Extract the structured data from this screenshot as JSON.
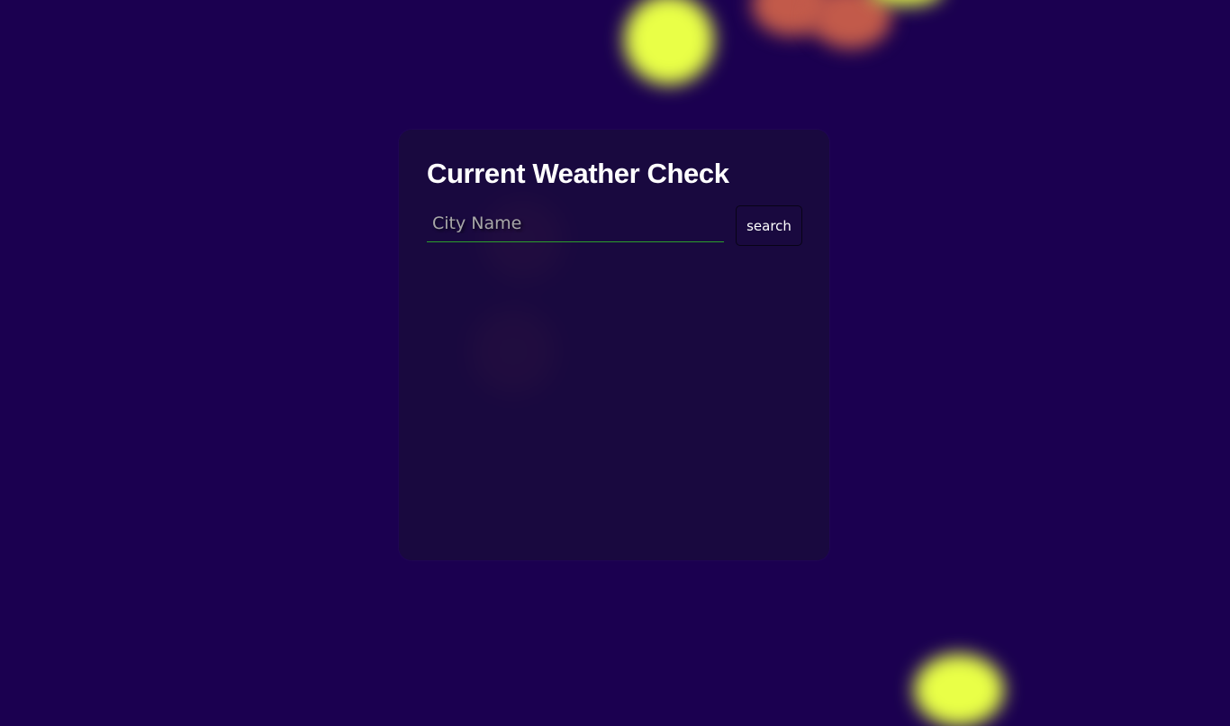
{
  "app": {
    "title": "Current Weather Check"
  },
  "search": {
    "placeholder": "City Name",
    "button_label": "search"
  },
  "theme": {
    "background": "#1b0050",
    "card": "#190a3e",
    "accent": "#2ca02c",
    "blob_yellow": "#e9ff47",
    "blob_red": "#c25a4a"
  }
}
